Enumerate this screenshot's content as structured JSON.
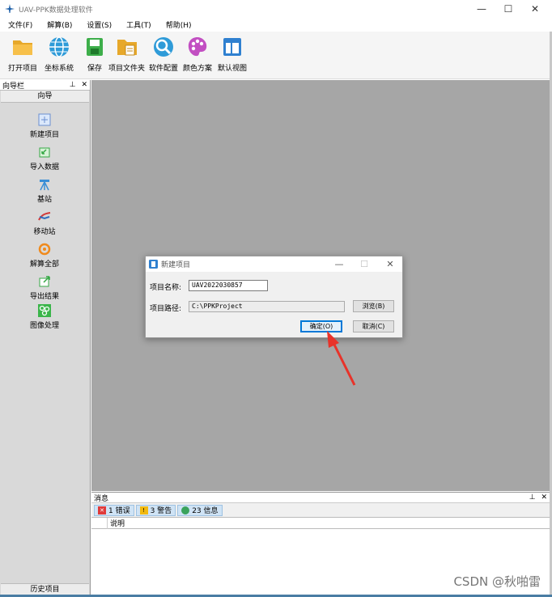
{
  "window": {
    "title": "UAV-PPK数据处理软件",
    "controls": {
      "minimize": "—",
      "maximize": "☐",
      "close": "✕"
    }
  },
  "menu": [
    {
      "label": "文件(F)"
    },
    {
      "label": "解算(B)"
    },
    {
      "label": "设置(S)"
    },
    {
      "label": "工具(T)"
    },
    {
      "label": "帮助(H)"
    }
  ],
  "toolbar": [
    {
      "label": "打开项目",
      "icon": "folder-open-icon"
    },
    {
      "label": "坐标系统",
      "icon": "globe-icon"
    },
    {
      "label": "保存",
      "icon": "save-icon"
    },
    {
      "label": "项目文件夹",
      "icon": "project-folder-icon"
    },
    {
      "label": "软件配置",
      "icon": "settings-icon"
    },
    {
      "label": "颜色方案",
      "icon": "palette-icon"
    },
    {
      "label": "默认视图",
      "icon": "layout-icon"
    }
  ],
  "guide_panel": {
    "header": "向导栏",
    "pin": "⊥",
    "close": "✕",
    "tab": "向导",
    "items": [
      {
        "label": "新建项目",
        "icon": "new-project-icon"
      },
      {
        "label": "导入数据",
        "icon": "import-data-icon"
      },
      {
        "label": "基站",
        "icon": "base-station-icon"
      },
      {
        "label": "移动站",
        "icon": "rover-icon"
      },
      {
        "label": "解算全部",
        "icon": "solve-all-icon"
      },
      {
        "label": "导出结果",
        "icon": "export-icon"
      },
      {
        "label": "图像处理",
        "icon": "image-process-icon"
      }
    ],
    "history": "历史项目"
  },
  "dialog": {
    "title": "新建项目",
    "name_label": "项目名称:",
    "name_value": "UAV2022030857",
    "path_label": "项目路径:",
    "path_value": "C:\\PPKProject",
    "browse": "浏览(B)",
    "ok": "确定(O)",
    "cancel": "取消(C)"
  },
  "message_panel": {
    "header": "消息",
    "pin": "⊥",
    "close": "✕",
    "tabs": [
      {
        "label": "1 错误",
        "color": "#e03a3a"
      },
      {
        "label": "3 警告",
        "color": "#f2b90f"
      },
      {
        "label": "23 信息",
        "color": "#3aa35c"
      }
    ],
    "column": "说明"
  },
  "watermark": "CSDN @秋啪雷",
  "colors": {
    "workspace": "#a6a6a6",
    "accent": "#0078d7",
    "arrow": "#e8332a"
  }
}
